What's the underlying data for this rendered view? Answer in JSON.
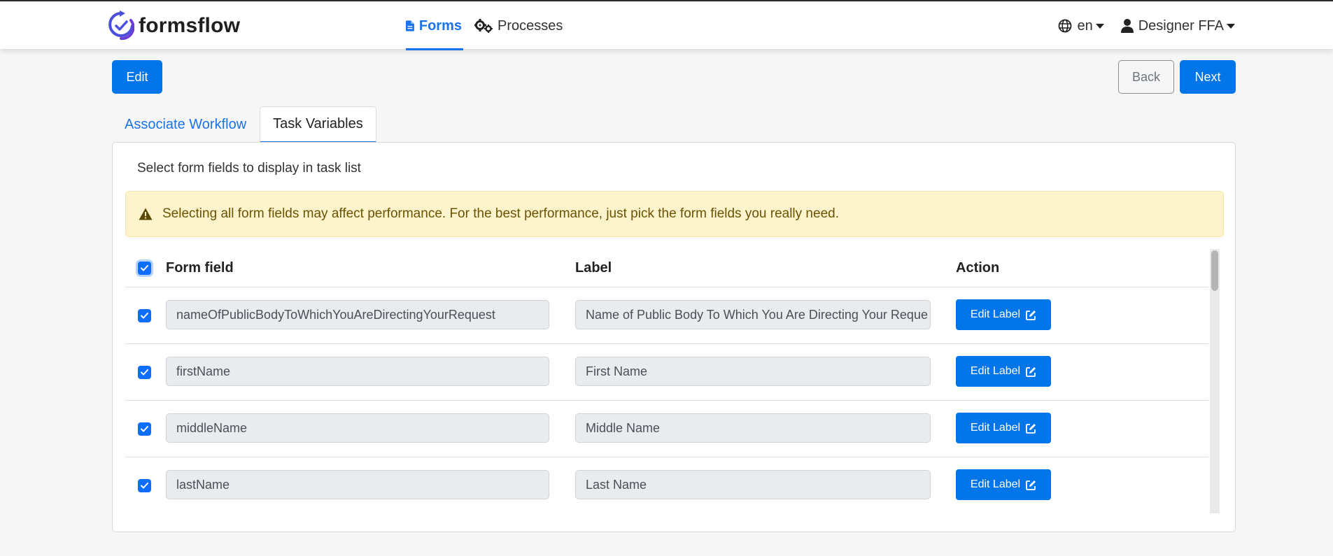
{
  "header": {
    "brand": "formsflow",
    "nav": [
      {
        "label": "Forms",
        "icon": "file-icon",
        "active": true
      },
      {
        "label": "Processes",
        "icon": "gears-icon",
        "active": false
      }
    ],
    "language": "en",
    "user": "Designer FFA"
  },
  "toolbar": {
    "edit_label": "Edit",
    "back_label": "Back",
    "next_label": "Next"
  },
  "tabs": [
    {
      "label": "Associate Workflow",
      "active": false
    },
    {
      "label": "Task Variables",
      "active": true
    }
  ],
  "panel": {
    "title": "Select form fields to display in task list",
    "warning": "Selecting all form fields may affect performance. For the best performance, just pick the form fields you really need.",
    "columns": {
      "form_field": "Form field",
      "label": "Label",
      "action": "Action"
    },
    "rows": [
      {
        "form_field": "nameOfPublicBodyToWhichYouAreDirectingYourRequest",
        "label": "Name of Public Body To Which You Are Directing Your Reque",
        "action": "Edit Label"
      },
      {
        "form_field": "firstName",
        "label": "First Name",
        "action": "Edit Label"
      },
      {
        "form_field": "middleName",
        "label": "Middle Name",
        "action": "Edit Label"
      },
      {
        "form_field": "lastName",
        "label": "Last Name",
        "action": "Edit Label"
      }
    ]
  },
  "colors": {
    "primary": "#0275e8",
    "link": "#1a73e8",
    "warning_bg": "#fdf3cd",
    "warning_text": "#6b5300"
  }
}
